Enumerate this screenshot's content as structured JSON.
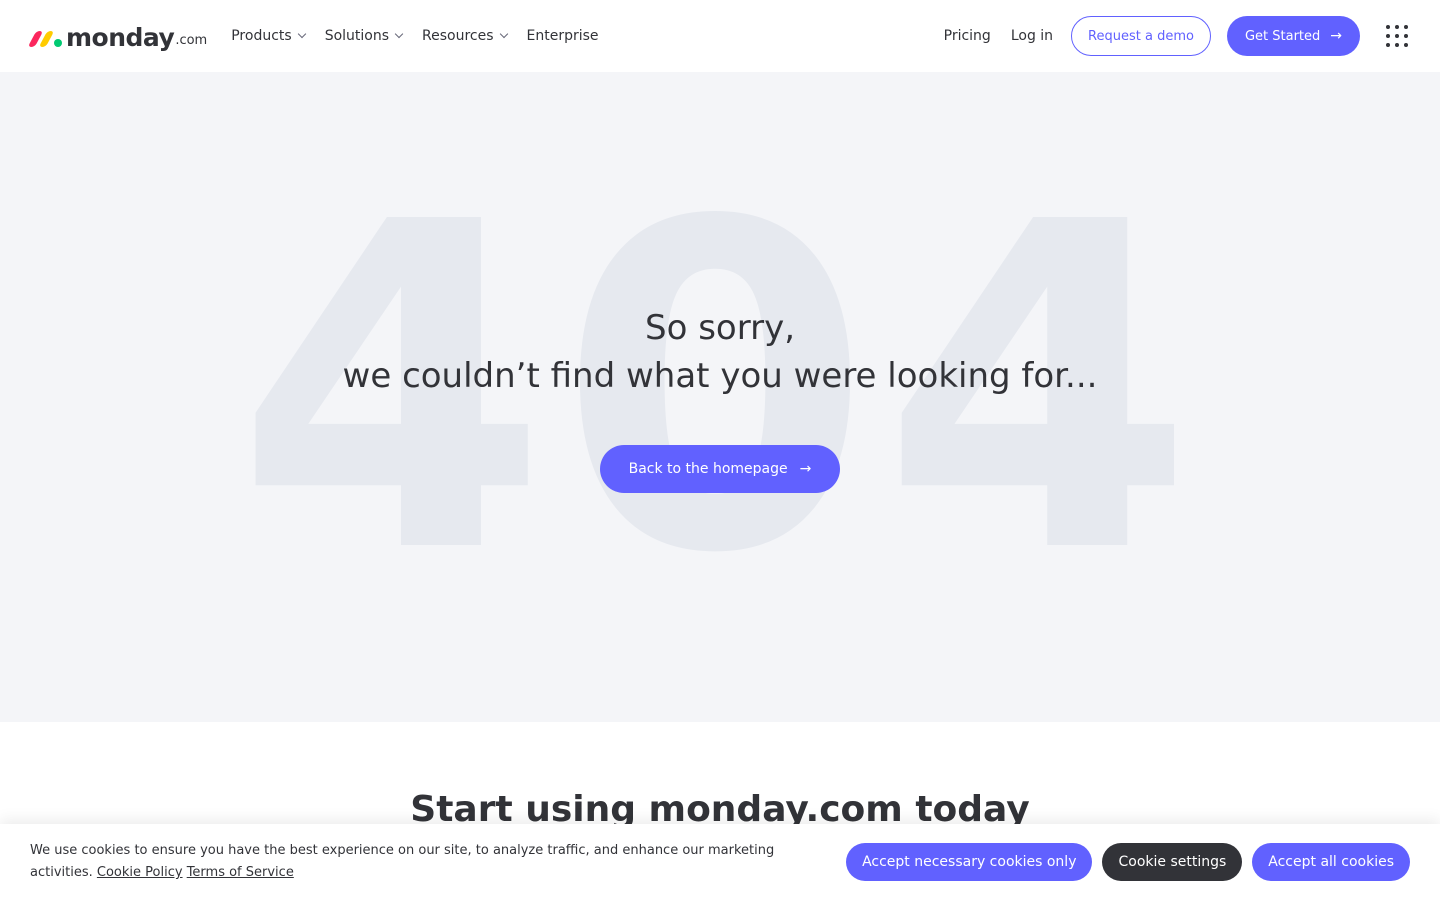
{
  "colors": {
    "brand_primary": "#6161ff",
    "text": "#323338",
    "hero_bg": "#f4f5f8",
    "bg_404": "#e6e9ef",
    "logo_red": "#fb275d",
    "logo_yellow": "#ffcb00",
    "logo_green": "#00ca72"
  },
  "header": {
    "logo": {
      "word": "monday",
      "tld": ".com"
    },
    "nav": [
      {
        "label": "Products",
        "has_dropdown": true
      },
      {
        "label": "Solutions",
        "has_dropdown": true
      },
      {
        "label": "Resources",
        "has_dropdown": true
      },
      {
        "label": "Enterprise",
        "has_dropdown": false
      }
    ],
    "pricing_label": "Pricing",
    "login_label": "Log in",
    "request_demo_label": "Request a demo",
    "get_started_label": "Get Started",
    "apps_icon": "grid-dots-icon"
  },
  "hero": {
    "background_number": "404",
    "line1": "So sorry,",
    "line2": "we couldn’t find what you were looking for...",
    "cta_label": "Back to the homepage",
    "cta_icon": "arrow-right-icon"
  },
  "start_section": {
    "title": "Start using monday.com today"
  },
  "cookie_banner": {
    "text": "We use cookies to ensure you have the best experience on our site, to analyze traffic, and enhance our marketing activities.",
    "cookie_policy_label": "Cookie Policy",
    "terms_label": "Terms of Service",
    "accept_necessary_label": "Accept necessary cookies only",
    "settings_label": "Cookie settings",
    "accept_all_label": "Accept all cookies"
  }
}
